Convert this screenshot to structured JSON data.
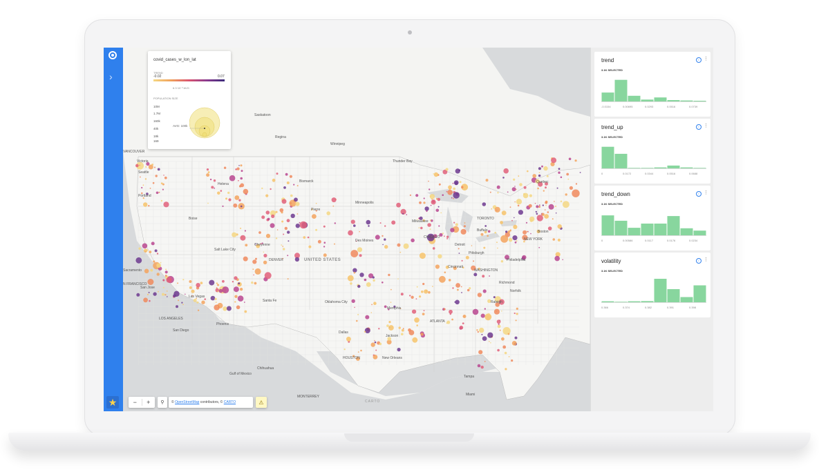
{
  "map": {
    "country_label": "UNITED STATES",
    "carto_watermark": "CARTO",
    "cities": [
      {
        "name": "VANCOUVER",
        "class": "city"
      },
      {
        "name": "Victoria",
        "class": "city"
      },
      {
        "name": "Seattle",
        "class": "city"
      },
      {
        "name": "Portland",
        "class": "city"
      },
      {
        "name": "Boise",
        "class": "city"
      },
      {
        "name": "Helena",
        "class": "city"
      },
      {
        "name": "Bismarck",
        "class": "city"
      },
      {
        "name": "Regina",
        "class": "city"
      },
      {
        "name": "Saskatoon",
        "class": "city"
      },
      {
        "name": "Winnipeg",
        "class": "city"
      },
      {
        "name": "Thunder Bay",
        "class": "city"
      },
      {
        "name": "Quebec",
        "class": "city"
      },
      {
        "name": "Minneapolis",
        "class": "city"
      },
      {
        "name": "Pierre",
        "class": "city"
      },
      {
        "name": "Cheyenne",
        "class": "city"
      },
      {
        "name": "Salt Lake City",
        "class": "city"
      },
      {
        "name": "DENVER",
        "class": "city"
      },
      {
        "name": "Sacramento",
        "class": "city"
      },
      {
        "name": "N FRANCISCO",
        "class": "city"
      },
      {
        "name": "San Jose",
        "class": "city"
      },
      {
        "name": "Las Vegas",
        "class": "city"
      },
      {
        "name": "LOS ANGELES",
        "class": "city"
      },
      {
        "name": "San Diego",
        "class": "city"
      },
      {
        "name": "Phoenix",
        "class": "city"
      },
      {
        "name": "Santa Fe",
        "class": "city"
      },
      {
        "name": "Oklahoma City",
        "class": "city"
      },
      {
        "name": "Dallas",
        "class": "city"
      },
      {
        "name": "HOUSTON",
        "class": "city"
      },
      {
        "name": "New Orleans",
        "class": "city"
      },
      {
        "name": "Memphis",
        "class": "city"
      },
      {
        "name": "Jackson",
        "class": "city"
      },
      {
        "name": "ATLANTA",
        "class": "city"
      },
      {
        "name": "Tampa",
        "class": "city"
      },
      {
        "name": "Miami",
        "class": "city"
      },
      {
        "name": "Chihuahua",
        "class": "city"
      },
      {
        "name": "MONTERREY",
        "class": "city"
      },
      {
        "name": "Des Moines",
        "class": "city"
      },
      {
        "name": "CHICAGO",
        "class": "city"
      },
      {
        "name": "Milwaukee",
        "class": "city"
      },
      {
        "name": "Detroit",
        "class": "city"
      },
      {
        "name": "TORONTO",
        "class": "city"
      },
      {
        "name": "Buffalo",
        "class": "city"
      },
      {
        "name": "Cincinnati",
        "class": "city"
      },
      {
        "name": "Pittsburgh",
        "class": "city"
      },
      {
        "name": "WASHINGTON",
        "class": "city"
      },
      {
        "name": "Philadelphia",
        "class": "city"
      },
      {
        "name": "NEW YORK",
        "class": "city"
      },
      {
        "name": "Boston",
        "class": "city"
      },
      {
        "name": "Richmond",
        "class": "city"
      },
      {
        "name": "Norfolk",
        "class": "city"
      },
      {
        "name": "Raleigh",
        "class": "city"
      },
      {
        "name": "Gulf of Mexico",
        "class": "city"
      }
    ]
  },
  "legend": {
    "title": "covid_cases_w_lon_lat",
    "trend_label": "TREND",
    "trend_min": "-0.02",
    "trend_max": "0.07",
    "trend_avg": "6.3·10⁻³ AVG",
    "size_label": "POPULATION SIZE",
    "sizes": [
      "10M",
      "1.7M",
      "160k",
      "40k",
      "18k",
      "169"
    ],
    "size_avg": "AVG: 100k"
  },
  "controls": {
    "zoom_out": "−",
    "zoom_in": "+",
    "search_icon": "search-icon",
    "attribution_prefix": "©",
    "attribution_link1": "OpenStreetMap",
    "attribution_mid": "contributors, ©",
    "attribution_link2": "CARTO",
    "warning_icon": "⚠"
  },
  "widgets": [
    {
      "title": "trend",
      "selected": "3.1K SELECTED",
      "ticks": [
        "-0.0154",
        "0.00695",
        "0.0293",
        "0.0516",
        "0.0739"
      ],
      "values": [
        0.38,
        0.92,
        0.24,
        0.08,
        0.17,
        0.06,
        0.04,
        0.03
      ]
    },
    {
      "title": "trend_up",
      "selected": "3.1K SELECTED",
      "ticks": [
        "0",
        "0.0172",
        "0.0344",
        "0.0516",
        "0.0688"
      ],
      "values": [
        0.92,
        0.62,
        0.02,
        0.02,
        0.04,
        0.12,
        0.04,
        0.02
      ]
    },
    {
      "title": "trend_down",
      "selected": "3.1K SELECTED",
      "ticks": [
        "0",
        "0.00586",
        "0.0117",
        "0.0176",
        "0.0234"
      ],
      "values": [
        0.85,
        0.62,
        0.32,
        0.5,
        0.5,
        0.82,
        0.3,
        0.2
      ]
    },
    {
      "title": "volatility",
      "selected": "3.1K SELECTED",
      "ticks": [
        "0.366",
        "0.374",
        "0.382",
        "0.391",
        "0.398"
      ],
      "values": [
        0.04,
        0.02,
        0.04,
        0.05,
        1.0,
        0.56,
        0.22,
        0.72
      ]
    }
  ],
  "colors": {
    "accent": "#2f80ed",
    "histogram": "#88d69e"
  }
}
